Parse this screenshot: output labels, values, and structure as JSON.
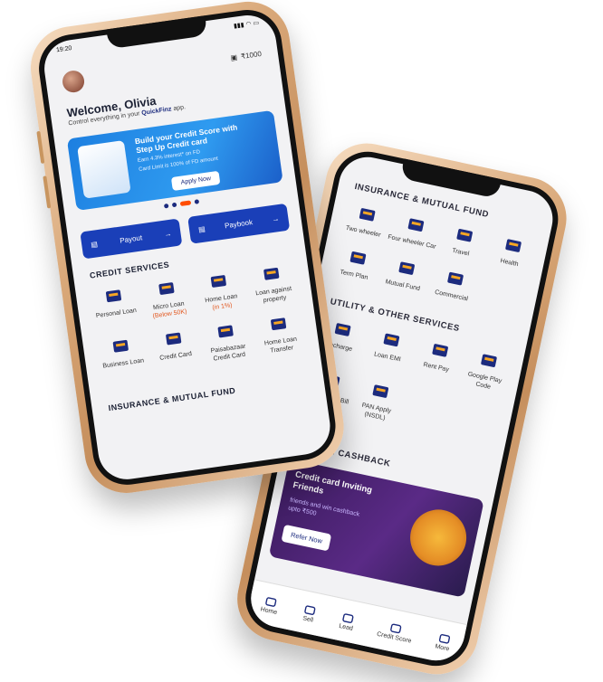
{
  "back_phone": {
    "insurance_title": "INSURANCE & MUTUAL FUND",
    "insurance_items": [
      {
        "label": "Two wheeler",
        "icon": "scooter-icon"
      },
      {
        "label": "Four wheeler Car",
        "icon": "car-icon"
      },
      {
        "label": "Travel",
        "icon": "travel-icon"
      },
      {
        "label": "Health",
        "icon": "umbrella-icon"
      },
      {
        "label": "Term Plan",
        "icon": "term-plan-icon"
      },
      {
        "label": "Mutual Fund",
        "icon": "money-bag-icon"
      },
      {
        "label": "Commercial",
        "icon": "truck-icon"
      }
    ],
    "utility_title": "UTILITY & OTHER SERVICES",
    "utility_items": [
      {
        "label": "Recharge",
        "icon": "phone-icon"
      },
      {
        "label": "Loan EMI",
        "icon": "money-hand-icon"
      },
      {
        "label": "Rent Pay",
        "icon": "house-icon"
      },
      {
        "label": "Google Play Code",
        "icon": "play-icon"
      },
      {
        "label": "Credit Card Bill Pay",
        "icon": "credit-card-icon"
      },
      {
        "label": "PAN Apply (NSDL)",
        "icon": "pan-card-icon"
      }
    ],
    "cashback_title": "& EARN CASHBACK",
    "promo": {
      "title": "Credit card Inviting Friends",
      "subtitle": "friends and win cashback upto ₹500",
      "button": "Refer Now"
    },
    "tabs": [
      {
        "label": "Home",
        "icon": "home-icon"
      },
      {
        "label": "Sell",
        "icon": "sell-icon"
      },
      {
        "label": "Lead",
        "icon": "lead-icon"
      },
      {
        "label": "Credit Score",
        "icon": "gauge-icon"
      },
      {
        "label": "More",
        "icon": "chevron-up-icon"
      }
    ]
  },
  "front_phone": {
    "time": "19:20",
    "wallet_amount": "₹1000",
    "welcome": "Welcome, Olivia",
    "tagline_prefix": "Control everything in your",
    "tagline_brand": "QuickFinz",
    "tagline_suffix": "app.",
    "banner": {
      "title": "Build your Credit Score with Step Up Credit card",
      "points": [
        "Earn 4.3% interest* on FD",
        "Card Limit is 100% of FD amount"
      ],
      "button": "Apply Now"
    },
    "actions": [
      {
        "label": "Payout",
        "icon": "payout-icon"
      },
      {
        "label": "Paybook",
        "icon": "paybook-icon"
      }
    ],
    "credit_title": "CREDIT SERVICES",
    "credit_items": [
      {
        "label": "Personal Loan",
        "sub": "",
        "icon": "personal-loan-icon"
      },
      {
        "label": "Micro Loan",
        "sub": "(Below 50K)",
        "icon": "micro-loan-icon"
      },
      {
        "label": "Home Loan",
        "sub": "(in 1%)",
        "icon": "home-loan-icon"
      },
      {
        "label": "Loan against property",
        "sub": "",
        "icon": "handshake-icon"
      },
      {
        "label": "Business Loan",
        "sub": "",
        "icon": "business-loan-icon"
      },
      {
        "label": "Credit Card",
        "sub": "",
        "icon": "credit-card-icon"
      },
      {
        "label": "Paisabazaar Credit Card",
        "sub": "",
        "icon": "card-stack-icon"
      },
      {
        "label": "Home Loan Transfer",
        "sub": "",
        "icon": "transfer-icon"
      }
    ],
    "insurance_title": "INSURANCE & MUTUAL FUND"
  },
  "colors": {
    "brand_blue": "#1a3fb8",
    "accent_orange": "#ff4d00",
    "gold_frame": "#d9a879"
  }
}
